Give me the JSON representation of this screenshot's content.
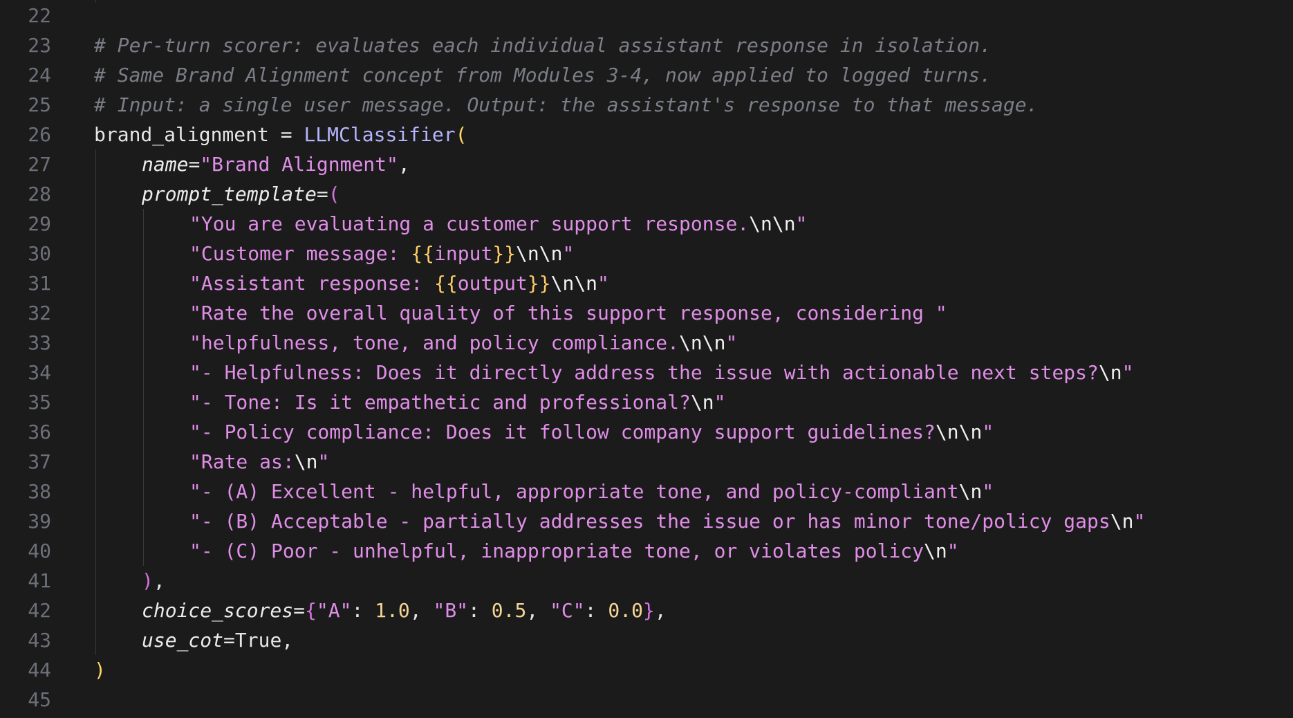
{
  "editor": {
    "lines": [
      {
        "n": "22",
        "indent": 0,
        "tokens": []
      },
      {
        "n": "23",
        "indent": 0,
        "tokens": [
          {
            "c": "comment",
            "t": "# Per-turn scorer: evaluates each individual assistant response in isolation."
          }
        ]
      },
      {
        "n": "24",
        "indent": 0,
        "tokens": [
          {
            "c": "comment",
            "t": "# Same Brand Alignment concept from Modules 3-4, now applied to logged turns."
          }
        ]
      },
      {
        "n": "25",
        "indent": 0,
        "tokens": [
          {
            "c": "comment",
            "t": "# Input: a single user message. Output: the assistant's response to that message."
          }
        ]
      },
      {
        "n": "26",
        "indent": 0,
        "tokens": [
          {
            "c": "plain",
            "t": "brand_alignment = "
          },
          {
            "c": "func",
            "t": "LLMClassifier"
          },
          {
            "c": "paren-y",
            "t": "("
          }
        ]
      },
      {
        "n": "27",
        "indent": 1,
        "tokens": [
          {
            "c": "kw",
            "t": "name"
          },
          {
            "c": "plain",
            "t": "="
          },
          {
            "c": "str",
            "t": "\"Brand Alignment\""
          },
          {
            "c": "plain",
            "t": ","
          }
        ]
      },
      {
        "n": "28",
        "indent": 1,
        "tokens": [
          {
            "c": "kw",
            "t": "prompt_template"
          },
          {
            "c": "plain",
            "t": "="
          },
          {
            "c": "paren-p",
            "t": "("
          }
        ]
      },
      {
        "n": "29",
        "indent": 2,
        "tokens": [
          {
            "c": "str",
            "t": "\"You are evaluating a customer support response."
          },
          {
            "c": "esc",
            "t": "\\n\\n"
          },
          {
            "c": "str",
            "t": "\""
          }
        ]
      },
      {
        "n": "30",
        "indent": 2,
        "tokens": [
          {
            "c": "str",
            "t": "\"Customer message: "
          },
          {
            "c": "interp",
            "t": "{{"
          },
          {
            "c": "str",
            "t": "input"
          },
          {
            "c": "interp",
            "t": "}}"
          },
          {
            "c": "esc",
            "t": "\\n\\n"
          },
          {
            "c": "str",
            "t": "\""
          }
        ]
      },
      {
        "n": "31",
        "indent": 2,
        "tokens": [
          {
            "c": "str",
            "t": "\"Assistant response: "
          },
          {
            "c": "interp",
            "t": "{{"
          },
          {
            "c": "str",
            "t": "output"
          },
          {
            "c": "interp",
            "t": "}}"
          },
          {
            "c": "esc",
            "t": "\\n\\n"
          },
          {
            "c": "str",
            "t": "\""
          }
        ]
      },
      {
        "n": "32",
        "indent": 2,
        "tokens": [
          {
            "c": "str",
            "t": "\"Rate the overall quality of this support response, considering \""
          }
        ]
      },
      {
        "n": "33",
        "indent": 2,
        "tokens": [
          {
            "c": "str",
            "t": "\"helpfulness, tone, and policy compliance."
          },
          {
            "c": "esc",
            "t": "\\n\\n"
          },
          {
            "c": "str",
            "t": "\""
          }
        ]
      },
      {
        "n": "34",
        "indent": 2,
        "tokens": [
          {
            "c": "str",
            "t": "\"- Helpfulness: Does it directly address the issue with actionable next steps?"
          },
          {
            "c": "esc",
            "t": "\\n"
          },
          {
            "c": "str",
            "t": "\""
          }
        ]
      },
      {
        "n": "35",
        "indent": 2,
        "tokens": [
          {
            "c": "str",
            "t": "\"- Tone: Is it empathetic and professional?"
          },
          {
            "c": "esc",
            "t": "\\n"
          },
          {
            "c": "str",
            "t": "\""
          }
        ]
      },
      {
        "n": "36",
        "indent": 2,
        "tokens": [
          {
            "c": "str",
            "t": "\"- Policy compliance: Does it follow company support guidelines?"
          },
          {
            "c": "esc",
            "t": "\\n\\n"
          },
          {
            "c": "str",
            "t": "\""
          }
        ]
      },
      {
        "n": "37",
        "indent": 2,
        "tokens": [
          {
            "c": "str",
            "t": "\"Rate as:"
          },
          {
            "c": "esc",
            "t": "\\n"
          },
          {
            "c": "str",
            "t": "\""
          }
        ]
      },
      {
        "n": "38",
        "indent": 2,
        "tokens": [
          {
            "c": "str",
            "t": "\"- (A) Excellent - helpful, appropriate tone, and policy-compliant"
          },
          {
            "c": "esc",
            "t": "\\n"
          },
          {
            "c": "str",
            "t": "\""
          }
        ]
      },
      {
        "n": "39",
        "indent": 2,
        "tokens": [
          {
            "c": "str",
            "t": "\"- (B) Acceptable - partially addresses the issue or has minor tone/policy gaps"
          },
          {
            "c": "esc",
            "t": "\\n"
          },
          {
            "c": "str",
            "t": "\""
          }
        ]
      },
      {
        "n": "40",
        "indent": 2,
        "tokens": [
          {
            "c": "str",
            "t": "\"- (C) Poor - unhelpful, inappropriate tone, or violates policy"
          },
          {
            "c": "esc",
            "t": "\\n"
          },
          {
            "c": "str",
            "t": "\""
          }
        ]
      },
      {
        "n": "41",
        "indent": 1,
        "tokens": [
          {
            "c": "paren-p",
            "t": ")"
          },
          {
            "c": "plain",
            "t": ","
          }
        ]
      },
      {
        "n": "42",
        "indent": 1,
        "tokens": [
          {
            "c": "kw",
            "t": "choice_scores"
          },
          {
            "c": "plain",
            "t": "="
          },
          {
            "c": "paren-p",
            "t": "{"
          },
          {
            "c": "str",
            "t": "\"A\""
          },
          {
            "c": "plain",
            "t": ": "
          },
          {
            "c": "num",
            "t": "1.0"
          },
          {
            "c": "plain",
            "t": ", "
          },
          {
            "c": "str",
            "t": "\"B\""
          },
          {
            "c": "plain",
            "t": ": "
          },
          {
            "c": "num",
            "t": "0.5"
          },
          {
            "c": "plain",
            "t": ", "
          },
          {
            "c": "str",
            "t": "\"C\""
          },
          {
            "c": "plain",
            "t": ": "
          },
          {
            "c": "num",
            "t": "0.0"
          },
          {
            "c": "paren-p",
            "t": "}"
          },
          {
            "c": "plain",
            "t": ","
          }
        ]
      },
      {
        "n": "43",
        "indent": 1,
        "tokens": [
          {
            "c": "kw",
            "t": "use_cot"
          },
          {
            "c": "plain",
            "t": "=True,"
          }
        ]
      },
      {
        "n": "44",
        "indent": 0,
        "tokens": [
          {
            "c": "paren-y",
            "t": ")"
          }
        ]
      },
      {
        "n": "45",
        "indent": 0,
        "tokens": []
      }
    ]
  }
}
